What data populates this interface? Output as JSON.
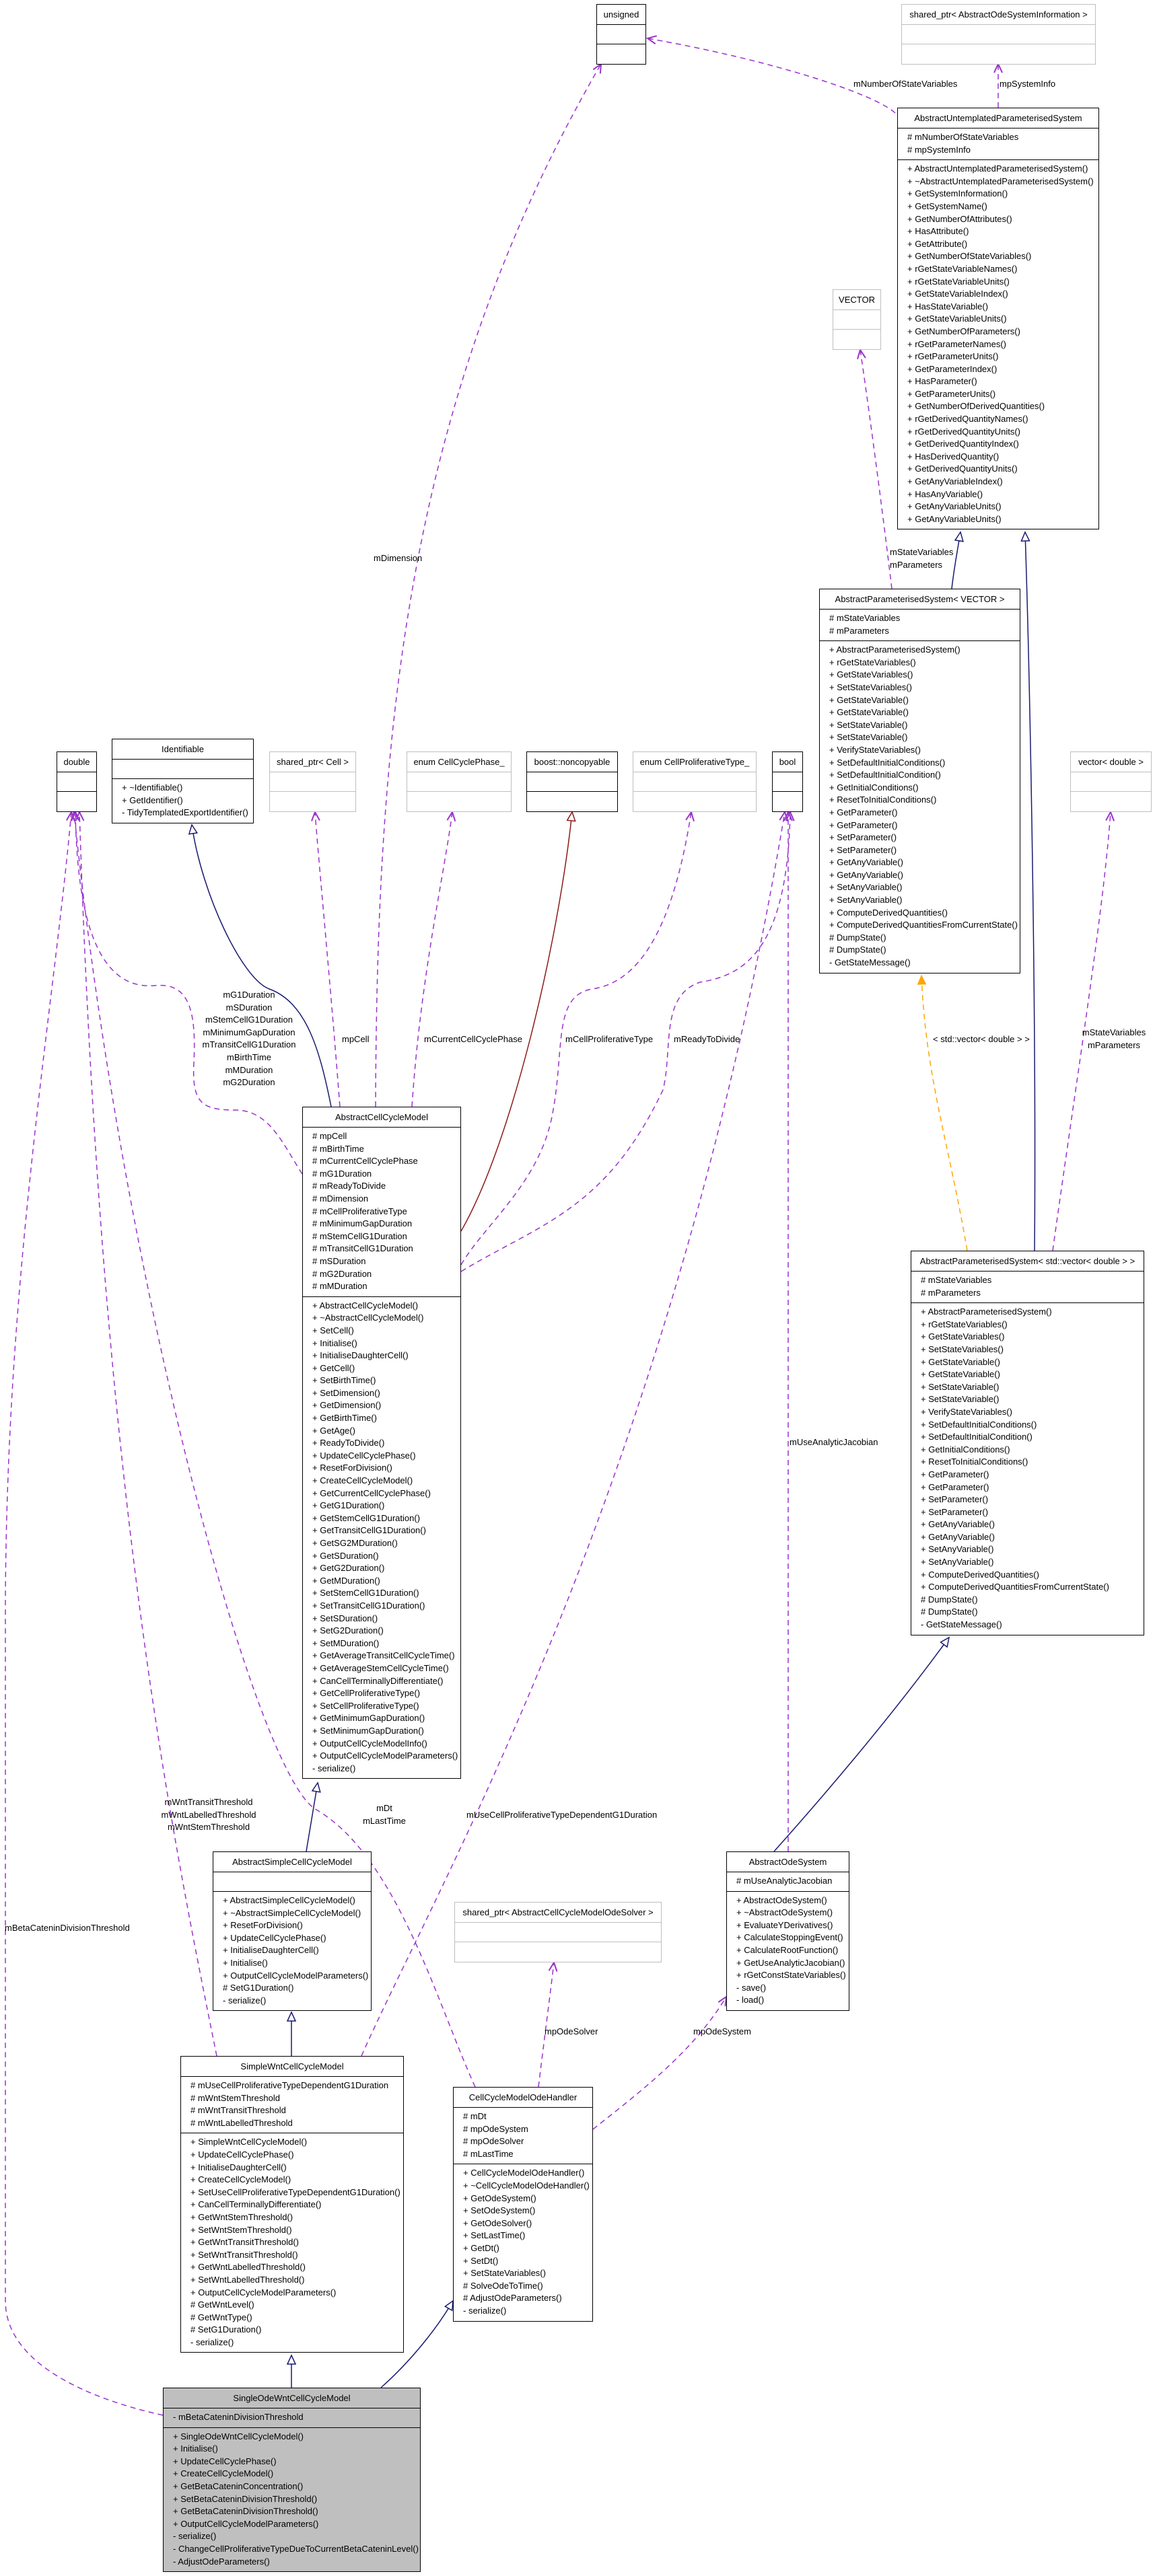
{
  "colors": {
    "association": "#9a32cd",
    "inheritance": "#191970",
    "private_inheritance": "#8b1a1a",
    "template": "#ffa500",
    "focus_fill": "#bfbfbf",
    "external_border": "#bfbfbf"
  },
  "classes": [
    {
      "name": "unsigned",
      "kind": "plain",
      "attributes": [],
      "methods": []
    },
    {
      "name": "shared_ptr< AbstractOdeSystemInformation >",
      "kind": "external",
      "attributes": [],
      "methods": []
    },
    {
      "name": "AbstractUntemplatedParameterisedSystem",
      "kind": "plain",
      "attributes": [
        "# mNumberOfStateVariables",
        "# mpSystemInfo"
      ],
      "methods": [
        "+ AbstractUntemplatedParameterisedSystem()",
        "+ ~AbstractUntemplatedParameterisedSystem()",
        "+ GetSystemInformation()",
        "+ GetSystemName()",
        "+ GetNumberOfAttributes()",
        "+ HasAttribute()",
        "+ GetAttribute()",
        "+ GetNumberOfStateVariables()",
        "+ rGetStateVariableNames()",
        "+ rGetStateVariableUnits()",
        "+ GetStateVariableIndex()",
        "+ HasStateVariable()",
        "+ GetStateVariableUnits()",
        "+ GetNumberOfParameters()",
        "+ rGetParameterNames()",
        "+ rGetParameterUnits()",
        "+ GetParameterIndex()",
        "+ HasParameter()",
        "+ GetParameterUnits()",
        "+ GetNumberOfDerivedQuantities()",
        "+ rGetDerivedQuantityNames()",
        "+ rGetDerivedQuantityUnits()",
        "+ GetDerivedQuantityIndex()",
        "+ HasDerivedQuantity()",
        "+ GetDerivedQuantityUnits()",
        "+ GetAnyVariableIndex()",
        "+ HasAnyVariable()",
        "+ GetAnyVariableUnits()",
        "+ GetAnyVariableUnits()"
      ]
    },
    {
      "name": "VECTOR",
      "kind": "external",
      "attributes": [],
      "methods": []
    },
    {
      "name": "AbstractParameterisedSystem< VECTOR >",
      "kind": "plain",
      "attributes": [
        "# mStateVariables",
        "# mParameters"
      ],
      "methods": [
        "+ AbstractParameterisedSystem()",
        "+ rGetStateVariables()",
        "+ GetStateVariables()",
        "+ SetStateVariables()",
        "+ GetStateVariable()",
        "+ GetStateVariable()",
        "+ SetStateVariable()",
        "+ SetStateVariable()",
        "+ VerifyStateVariables()",
        "+ SetDefaultInitialConditions()",
        "+ SetDefaultInitialCondition()",
        "+ GetInitialConditions()",
        "+ ResetToInitialConditions()",
        "+ GetParameter()",
        "+ GetParameter()",
        "+ SetParameter()",
        "+ SetParameter()",
        "+ GetAnyVariable()",
        "+ GetAnyVariable()",
        "+ SetAnyVariable()",
        "+ SetAnyVariable()",
        "+ ComputeDerivedQuantities()",
        "+ ComputeDerivedQuantitiesFromCurrentState()",
        "# DumpState()",
        "# DumpState()",
        "- GetStateMessage()"
      ]
    },
    {
      "name": "double",
      "kind": "plain",
      "attributes": [],
      "methods": []
    },
    {
      "name": "Identifiable",
      "kind": "plain",
      "attributes": [],
      "methods": [
        "+ ~Identifiable()",
        "+ GetIdentifier()",
        "- TidyTemplatedExportIdentifier()"
      ]
    },
    {
      "name": "shared_ptr< Cell >",
      "kind": "external",
      "attributes": [],
      "methods": []
    },
    {
      "name": "enum CellCyclePhase_",
      "kind": "external",
      "attributes": [],
      "methods": []
    },
    {
      "name": "boost::noncopyable",
      "kind": "plain",
      "attributes": [],
      "methods": []
    },
    {
      "name": "enum CellProliferativeType_",
      "kind": "external",
      "attributes": [],
      "methods": []
    },
    {
      "name": "bool",
      "kind": "plain",
      "attributes": [],
      "methods": []
    },
    {
      "name": "vector< double >",
      "kind": "external",
      "attributes": [],
      "methods": []
    },
    {
      "name": "AbstractCellCycleModel",
      "kind": "plain",
      "attributes": [
        "# mpCell",
        "# mBirthTime",
        "# mCurrentCellCyclePhase",
        "# mG1Duration",
        "# mReadyToDivide",
        "# mDimension",
        "# mCellProliferativeType",
        "# mMinimumGapDuration",
        "# mStemCellG1Duration",
        "# mTransitCellG1Duration",
        "# mSDuration",
        "# mG2Duration",
        "# mMDuration"
      ],
      "methods": [
        "+ AbstractCellCycleModel()",
        "+ ~AbstractCellCycleModel()",
        "+ SetCell()",
        "+ Initialise()",
        "+ InitialiseDaughterCell()",
        "+ GetCell()",
        "+ SetBirthTime()",
        "+ SetDimension()",
        "+ GetDimension()",
        "+ GetBirthTime()",
        "+ GetAge()",
        "+ ReadyToDivide()",
        "+ UpdateCellCyclePhase()",
        "+ ResetForDivision()",
        "+ CreateCellCycleModel()",
        "+ GetCurrentCellCyclePhase()",
        "+ GetG1Duration()",
        "+ GetStemCellG1Duration()",
        "+ GetTransitCellG1Duration()",
        "+ GetSG2MDuration()",
        "+ GetSDuration()",
        "+ GetG2Duration()",
        "+ GetMDuration()",
        "+ SetStemCellG1Duration()",
        "+ SetTransitCellG1Duration()",
        "+ SetSDuration()",
        "+ SetG2Duration()",
        "+ SetMDuration()",
        "+ GetAverageTransitCellCycleTime()",
        "+ GetAverageStemCellCycleTime()",
        "+ CanCellTerminallyDifferentiate()",
        "+ GetCellProliferativeType()",
        "+ SetCellProliferativeType()",
        "+ GetMinimumGapDuration()",
        "+ SetMinimumGapDuration()",
        "+ OutputCellCycleModelInfo()",
        "+ OutputCellCycleModelParameters()",
        "- serialize()"
      ]
    },
    {
      "name": "AbstractParameterisedSystem< std::vector< double > >",
      "kind": "plain",
      "attributes": [
        "# mStateVariables",
        "# mParameters"
      ],
      "methods": [
        "+ AbstractParameterisedSystem()",
        "+ rGetStateVariables()",
        "+ GetStateVariables()",
        "+ SetStateVariables()",
        "+ GetStateVariable()",
        "+ GetStateVariable()",
        "+ SetStateVariable()",
        "+ SetStateVariable()",
        "+ VerifyStateVariables()",
        "+ SetDefaultInitialConditions()",
        "+ SetDefaultInitialCondition()",
        "+ GetInitialConditions()",
        "+ ResetToInitialConditions()",
        "+ GetParameter()",
        "+ GetParameter()",
        "+ SetParameter()",
        "+ SetParameter()",
        "+ GetAnyVariable()",
        "+ GetAnyVariable()",
        "+ SetAnyVariable()",
        "+ SetAnyVariable()",
        "+ ComputeDerivedQuantities()",
        "+ ComputeDerivedQuantitiesFromCurrentState()",
        "# DumpState()",
        "# DumpState()",
        "- GetStateMessage()"
      ]
    },
    {
      "name": "AbstractSimpleCellCycleModel",
      "kind": "plain",
      "attributes": [],
      "methods": [
        "+ AbstractSimpleCellCycleModel()",
        "+ ~AbstractSimpleCellCycleModel()",
        "+ ResetForDivision()",
        "+ UpdateCellCyclePhase()",
        "+ InitialiseDaughterCell()",
        "+ Initialise()",
        "+ OutputCellCycleModelParameters()",
        "# SetG1Duration()",
        "- serialize()"
      ]
    },
    {
      "name": "AbstractOdeSystem",
      "kind": "plain",
      "attributes": [
        "# mUseAnalyticJacobian"
      ],
      "methods": [
        "+ AbstractOdeSystem()",
        "+ ~AbstractOdeSystem()",
        "+ EvaluateYDerivatives()",
        "+ CalculateStoppingEvent()",
        "+ CalculateRootFunction()",
        "+ GetUseAnalyticJacobian()",
        "+ rGetConstStateVariables()",
        "- save()",
        "- load()"
      ]
    },
    {
      "name": "shared_ptr< AbstractCellCycleModelOdeSolver >",
      "kind": "external",
      "attributes": [],
      "methods": []
    },
    {
      "name": "SimpleWntCellCycleModel",
      "kind": "plain",
      "attributes": [
        "# mUseCellProliferativeTypeDependentG1Duration",
        "# mWntStemThreshold",
        "# mWntTransitThreshold",
        "# mWntLabelledThreshold"
      ],
      "methods": [
        "+ SimpleWntCellCycleModel()",
        "+ UpdateCellCyclePhase()",
        "+ InitialiseDaughterCell()",
        "+ CreateCellCycleModel()",
        "+ SetUseCellProliferativeTypeDependentG1Duration()",
        "+ CanCellTerminallyDifferentiate()",
        "+ GetWntStemThreshold()",
        "+ SetWntStemThreshold()",
        "+ GetWntTransitThreshold()",
        "+ SetWntTransitThreshold()",
        "+ GetWntLabelledThreshold()",
        "+ SetWntLabelledThreshold()",
        "+ OutputCellCycleModelParameters()",
        "# GetWntLevel()",
        "# GetWntType()",
        "# SetG1Duration()",
        "- serialize()"
      ]
    },
    {
      "name": "CellCycleModelOdeHandler",
      "kind": "plain",
      "attributes": [
        "# mDt",
        "# mpOdeSystem",
        "# mpOdeSolver",
        "# mLastTime"
      ],
      "methods": [
        "+ CellCycleModelOdeHandler()",
        "+ ~CellCycleModelOdeHandler()",
        "+ GetOdeSystem()",
        "+ SetOdeSystem()",
        "+ GetOdeSolver()",
        "+ SetLastTime()",
        "+ GetDt()",
        "+ SetDt()",
        "+ SetStateVariables()",
        "# SolveOdeToTime()",
        "# AdjustOdeParameters()",
        "- serialize()"
      ]
    },
    {
      "name": "SingleOdeWntCellCycleModel",
      "kind": "focus",
      "attributes": [
        "- mBetaCateninDivisionThreshold"
      ],
      "methods": [
        "+ SingleOdeWntCellCycleModel()",
        "+ Initialise()",
        "+ UpdateCellCyclePhase()",
        "+ CreateCellCycleModel()",
        "+ GetBetaCateninConcentration()",
        "+ SetBetaCateninDivisionThreshold()",
        "+ GetBetaCateninDivisionThreshold()",
        "+ OutputCellCycleModelParameters()",
        "- serialize()",
        "- ChangeCellProliferativeTypeDueToCurrentBetaCateninLevel()",
        "- AdjustOdeParameters()"
      ]
    }
  ],
  "edges": [
    {
      "from": "AbstractCellCycleModel",
      "to": "Identifiable",
      "type": "inheritance",
      "labels": []
    },
    {
      "from": "AbstractCellCycleModel",
      "to": "boost::noncopyable",
      "type": "private_inheritance",
      "labels": []
    },
    {
      "from": "AbstractCellCycleModel",
      "to": "double",
      "type": "association",
      "labels": [
        "mG1Duration",
        "mSDuration",
        "mStemCellG1Duration",
        "mMinimumGapDuration",
        "mTransitCellG1Duration",
        "mBirthTime",
        "mMDuration",
        "mG2Duration"
      ]
    },
    {
      "from": "AbstractCellCycleModel",
      "to": "shared_ptr< Cell >",
      "type": "association",
      "labels": [
        "mpCell"
      ]
    },
    {
      "from": "AbstractCellCycleModel",
      "to": "unsigned",
      "type": "association",
      "labels": [
        "mDimension"
      ]
    },
    {
      "from": "AbstractCellCycleModel",
      "to": "enum CellCyclePhase_",
      "type": "association",
      "labels": [
        "mCurrentCellCyclePhase"
      ]
    },
    {
      "from": "AbstractCellCycleModel",
      "to": "enum CellProliferativeType_",
      "type": "association",
      "labels": [
        "mCellProliferativeType"
      ]
    },
    {
      "from": "AbstractCellCycleModel",
      "to": "bool",
      "type": "association",
      "labels": [
        "mReadyToDivide"
      ]
    },
    {
      "from": "AbstractUntemplatedParameterisedSystem",
      "to": "unsigned",
      "type": "association",
      "labels": [
        "mNumberOfStateVariables"
      ]
    },
    {
      "from": "AbstractUntemplatedParameterisedSystem",
      "to": "shared_ptr< AbstractOdeSystemInformation >",
      "type": "association",
      "labels": [
        "mpSystemInfo"
      ]
    },
    {
      "from": "AbstractParameterisedSystem< VECTOR >",
      "to": "AbstractUntemplatedParameterisedSystem",
      "type": "inheritance",
      "labels": []
    },
    {
      "from": "AbstractParameterisedSystem< VECTOR >",
      "to": "VECTOR",
      "type": "association",
      "labels": [
        "mStateVariables",
        "mParameters"
      ]
    },
    {
      "from": "AbstractParameterisedSystem< std::vector< double > >",
      "to": "AbstractUntemplatedParameterisedSystem",
      "type": "inheritance",
      "labels": []
    },
    {
      "from": "AbstractParameterisedSystem< std::vector< double > >",
      "to": "AbstractParameterisedSystem< VECTOR >",
      "type": "template",
      "labels": [
        "< std::vector< double > >"
      ]
    },
    {
      "from": "AbstractParameterisedSystem< std::vector< double > >",
      "to": "vector< double >",
      "type": "association",
      "labels": [
        "mStateVariables",
        "mParameters"
      ]
    },
    {
      "from": "AbstractOdeSystem",
      "to": "AbstractParameterisedSystem< std::vector< double > >",
      "type": "inheritance",
      "labels": []
    },
    {
      "from": "AbstractOdeSystem",
      "to": "bool",
      "type": "association",
      "labels": [
        "mUseAnalyticJacobian"
      ]
    },
    {
      "from": "AbstractSimpleCellCycleModel",
      "to": "AbstractCellCycleModel",
      "type": "inheritance",
      "labels": []
    },
    {
      "from": "SimpleWntCellCycleModel",
      "to": "AbstractSimpleCellCycleModel",
      "type": "inheritance",
      "labels": []
    },
    {
      "from": "SimpleWntCellCycleModel",
      "to": "double",
      "type": "association",
      "labels": [
        "mWntTransitThreshold",
        "mWntLabelledThreshold",
        "mWntStemThreshold"
      ]
    },
    {
      "from": "SimpleWntCellCycleModel",
      "to": "bool",
      "type": "association",
      "labels": [
        "mUseCellProliferativeTypeDependentG1Duration"
      ]
    },
    {
      "from": "CellCycleModelOdeHandler",
      "to": "double",
      "type": "association",
      "labels": [
        "mDt",
        "mLastTime"
      ]
    },
    {
      "from": "CellCycleModelOdeHandler",
      "to": "shared_ptr< AbstractCellCycleModelOdeSolver >",
      "type": "association",
      "labels": [
        "mpOdeSolver"
      ]
    },
    {
      "from": "CellCycleModelOdeHandler",
      "to": "AbstractOdeSystem",
      "type": "association",
      "labels": [
        "mpOdeSystem"
      ]
    },
    {
      "from": "SingleOdeWntCellCycleModel",
      "to": "SimpleWntCellCycleModel",
      "type": "inheritance",
      "labels": []
    },
    {
      "from": "SingleOdeWntCellCycleModel",
      "to": "CellCycleModelOdeHandler",
      "type": "inheritance",
      "labels": []
    },
    {
      "from": "SingleOdeWntCellCycleModel",
      "to": "double",
      "type": "association",
      "labels": [
        "mBetaCateninDivisionThreshold"
      ]
    }
  ]
}
